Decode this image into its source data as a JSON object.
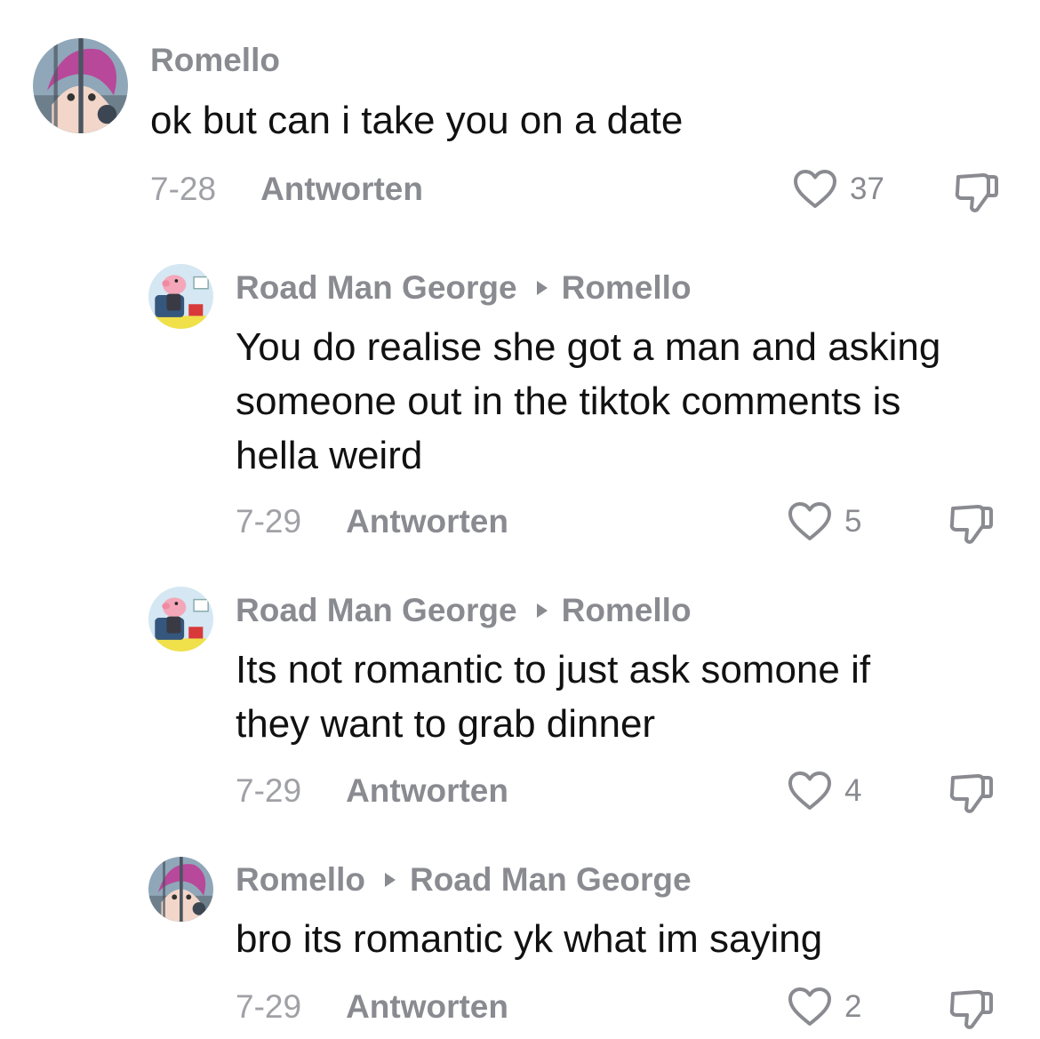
{
  "comments": [
    {
      "author": "Romello",
      "reply_to": "",
      "text": "ok but can i take you on a date",
      "date": "7-28",
      "reply_label": "Antworten",
      "likes": "37",
      "avatar": "anime-girl-avatar"
    },
    {
      "author": "Road Man George",
      "reply_to": "Romello",
      "text": "You do realise she got a man and asking\nsomeone out in the tiktok comments is\nhella weird",
      "date": "7-29",
      "reply_label": "Antworten",
      "likes": "5",
      "avatar": "pig-cartoon-avatar"
    },
    {
      "author": "Road Man George",
      "reply_to": "Romello",
      "text": "Its not romantic to just ask somone if\nthey want to grab dinner",
      "date": "7-29",
      "reply_label": "Antworten",
      "likes": "4",
      "avatar": "pig-cartoon-avatar"
    },
    {
      "author": "Romello",
      "reply_to": "Road Man George",
      "text": "bro its romantic yk what im saying",
      "date": "7-29",
      "reply_label": "Antworten",
      "likes": "2",
      "avatar": "anime-girl-avatar"
    }
  ],
  "icons": {
    "like": "heart-outline-icon",
    "dislike": "thumbs-down-icon",
    "reply_arrow": "triangle-right-icon"
  },
  "colors": {
    "username": "#8a8b91",
    "text": "#111111",
    "meta": "#a0a1a6"
  }
}
